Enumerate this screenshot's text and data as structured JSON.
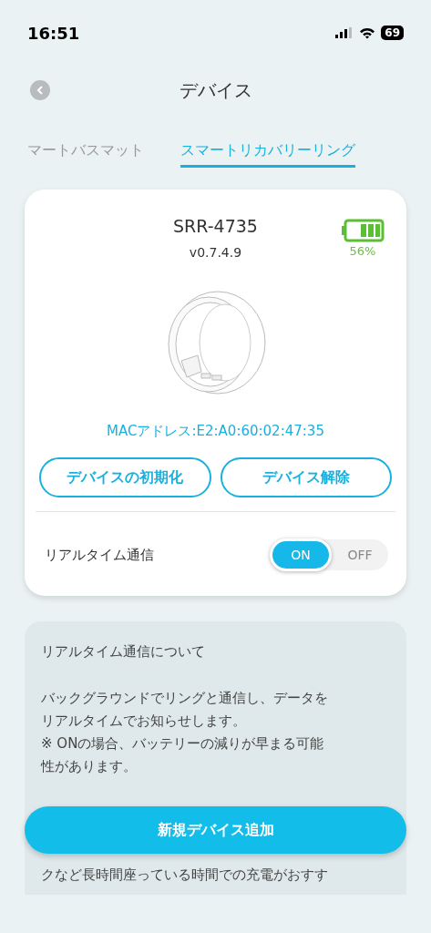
{
  "status_bar": {
    "time": "16:51",
    "battery": "69"
  },
  "header": {
    "title": "デバイス"
  },
  "tabs": [
    {
      "label": "マートバスマット",
      "selected": false
    },
    {
      "label": "スマートリカバリーリング",
      "selected": true
    }
  ],
  "device": {
    "name": "SRR-4735",
    "version": "v0.7.4.9",
    "battery_reading": "56%",
    "mac": "MACアドレス:E2:A0:60:02:47:35",
    "buttons": [
      "デバイスの初期化",
      "デバイス解除"
    ],
    "realtime": {
      "label": "リアルタイム通信",
      "options": [
        {
          "label": "ON",
          "selected": true
        },
        {
          "label": "OFF",
          "selected": false
        }
      ]
    }
  },
  "info": {
    "title": "リアルタイム通信について",
    "paragraph": "バックグラウンドでリングと通信し、データをリアルタイムでお知らせします。\n※ ONの場合、バッテリーの減りが早まる可能性があります。",
    "tail_line": "クなど長時間座っている時間での充電がおすす"
  },
  "add_button": "新規デバイス追加"
}
